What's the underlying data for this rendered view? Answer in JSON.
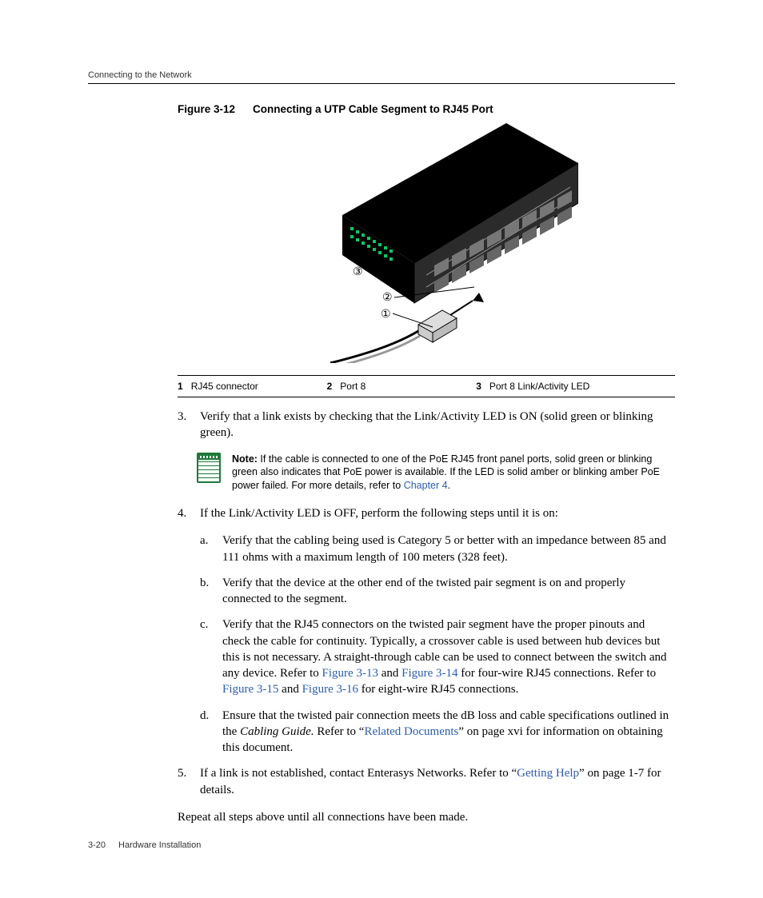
{
  "header": {
    "running": "Connecting to the Network"
  },
  "figure": {
    "label": "Figure 3-12",
    "title": "Connecting a UTP Cable Segment to RJ45 Port"
  },
  "callouts": {
    "c1": "1",
    "t1": "RJ45 connector",
    "c2": "2",
    "t2": "Port 8",
    "c3": "3",
    "t3": "Port 8 Link/Activity LED"
  },
  "steps": {
    "s3n": "3.",
    "s3": "Verify that a link exists by checking that the Link/Activity LED is ON (solid green or blinking green).",
    "s4n": "4.",
    "s4": "If the Link/Activity LED is OFF, perform the following steps until it is on:",
    "s5n": "5.",
    "s5a": "If a link is not established, contact Enterasys Networks. Refer to “",
    "s5link": "Getting Help",
    "s5b": "” on page 1-7 for details."
  },
  "subs": {
    "a_n": "a.",
    "a": "Verify that the cabling being used is Category 5 or better with an impedance between 85 and 111 ohms with a maximum length of 100 meters (328 feet).",
    "b_n": "b.",
    "b": "Verify that the device at the other end of the twisted pair segment is on and properly connected to the segment.",
    "c_n": "c.",
    "c1": "Verify that the RJ45 connectors on the twisted pair segment have the proper pinouts and check the cable for continuity. Typically, a crossover cable is used between hub devices but this is not necessary. A straight-through cable can be used to connect between the switch and any device. Refer to ",
    "c_l1": "Figure 3-13",
    "c2": " and ",
    "c_l2": "Figure 3-14",
    "c3": " for four-wire RJ45 connections. Refer to ",
    "c_l3": "Figure 3-15",
    "c4": " and ",
    "c_l4": "Figure 3-16",
    "c5": " for eight-wire RJ45 connections.",
    "d_n": "d.",
    "d1": "Ensure that the twisted pair connection meets the dB loss and cable specifications outlined in the ",
    "d_ital": "Cabling Guide.",
    "d2": " Refer to “",
    "d_link": "Related Documents",
    "d3": "” on page xvi for information on obtaining this document."
  },
  "note": {
    "label": "Note:",
    "t1": " If the cable is connected to one of the PoE RJ45 front panel ports, solid green or blinking green also indicates that PoE power is available. If the LED is solid amber or blinking amber PoE power failed. For more details, refer to ",
    "link": "Chapter 4",
    "t2": "."
  },
  "closing": "Repeat all steps above until all connections have been made.",
  "footer": {
    "page": "3-20",
    "section": "Hardware Installation"
  },
  "illu_labels": {
    "m1": "①",
    "m2": "②",
    "m3": "③"
  }
}
